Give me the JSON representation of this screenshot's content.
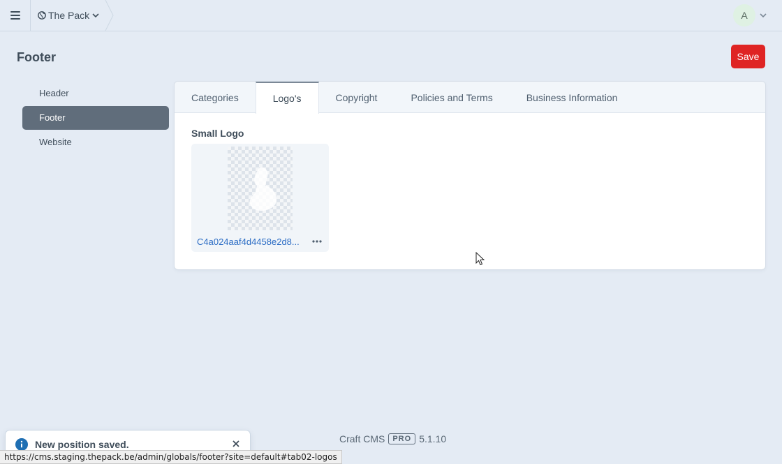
{
  "topbar": {
    "site_name": "The Pack",
    "user_initial": "A"
  },
  "page": {
    "title": "Footer",
    "save_label": "Save"
  },
  "sidebar": {
    "items": [
      {
        "label": "Header",
        "active": false
      },
      {
        "label": "Footer",
        "active": true
      },
      {
        "label": "Website",
        "active": false
      }
    ]
  },
  "tabs": [
    {
      "label": "Categories",
      "active": false
    },
    {
      "label": "Logo's",
      "active": true
    },
    {
      "label": "Copyright",
      "active": false
    },
    {
      "label": "Policies and Terms",
      "active": false
    },
    {
      "label": "Business Information",
      "active": false
    }
  ],
  "field": {
    "label": "Small Logo",
    "asset_name": "C4a024aaf4d4458e2d8..."
  },
  "footer": {
    "product": "Craft CMS",
    "edition": "PRO",
    "version": "5.1.10"
  },
  "toast": {
    "message": "New position saved."
  },
  "status_url": "https://cms.staging.thepack.be/admin/globals/footer?site=default#tab02-logos",
  "colors": {
    "save_button": "#df2424",
    "active_sidebar": "#606d7b",
    "link": "#2b6cc4",
    "background": "#e4ebf4"
  },
  "icons": {
    "menu": "hamburger-icon",
    "site": "globe-icon",
    "dropdown": "chevron-down-icon",
    "asset_actions": "ellipsis-icon",
    "toast": "info-icon",
    "close": "close-icon"
  }
}
